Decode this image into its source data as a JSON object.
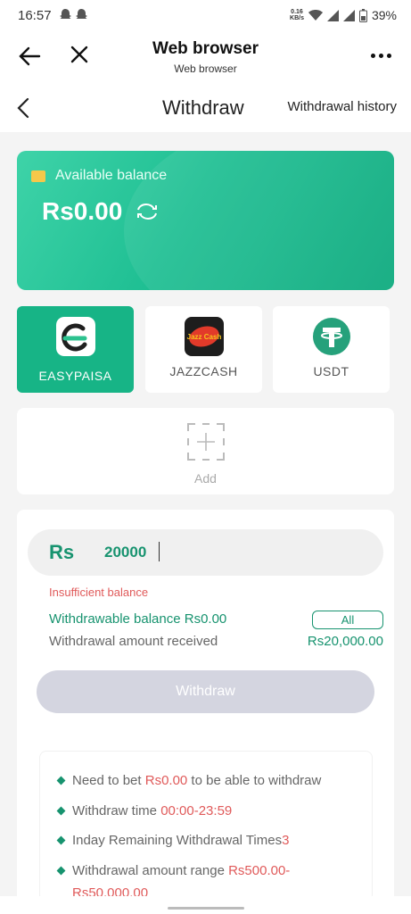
{
  "status": {
    "time": "16:57",
    "net_speed_value": "0.16",
    "net_speed_unit": "KB/s",
    "battery": "39%"
  },
  "browser": {
    "title": "Web browser",
    "subtitle": "Web browser"
  },
  "page": {
    "title": "Withdraw",
    "history_link": "Withdrawal history"
  },
  "balance": {
    "label": "Available balance",
    "amount": "Rs0.00"
  },
  "methods": [
    {
      "label": "EASYPAISA",
      "active": true,
      "icon": "easypaisa-logo"
    },
    {
      "label": "JAZZCASH",
      "active": false,
      "icon": "jazzcash-logo"
    },
    {
      "label": "USDT",
      "active": false,
      "icon": "tether-logo"
    }
  ],
  "jazzcash_logo_text": "Jazz Cash",
  "add": {
    "label": "Add"
  },
  "form": {
    "currency": "Rs",
    "amount_value": "20000",
    "error": "Insufficient balance",
    "withdrawable_label": "Withdrawable balance Rs0.00",
    "all_label": "All",
    "received_label": "Withdrawal amount received",
    "received_value": "Rs20,000.00",
    "submit_label": "Withdraw"
  },
  "rules": {
    "r1_pre": "Need to bet ",
    "r1_val": "Rs0.00",
    "r1_post": " to be able to withdraw",
    "r2_pre": "Withdraw time ",
    "r2_val": "00:00-23:59",
    "r3_pre": "Inday Remaining Withdrawal Times",
    "r3_val": "3",
    "r4_pre": "Withdrawal amount range ",
    "r4_val": "Rs500.00-Rs50,000.00"
  },
  "colors": {
    "accent": "#17b486",
    "accent_dark": "#17936f",
    "error": "#e05a5a",
    "disabled_button": "#d4d5e0"
  }
}
